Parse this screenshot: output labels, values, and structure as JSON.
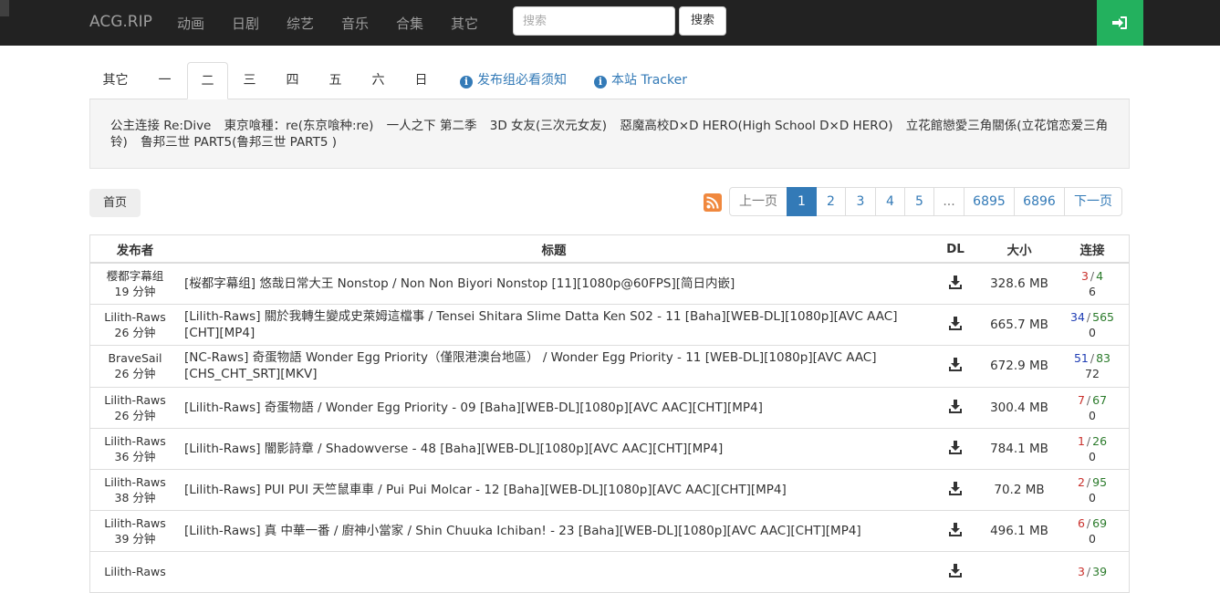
{
  "navbar": {
    "brand": "ACG.RIP",
    "links": [
      "动画",
      "日剧",
      "综艺",
      "音乐",
      "合集",
      "其它"
    ],
    "search_placeholder": "搜索",
    "search_button": "搜索",
    "login_icon": "sign-in-icon"
  },
  "tabs": {
    "days": [
      "其它",
      "一",
      "二",
      "三",
      "四",
      "五",
      "六",
      "日"
    ],
    "active": "二",
    "links": [
      "发布组必看须知",
      "本站 Tracker"
    ]
  },
  "schedule": [
    "公主连接 Re:Dive",
    "東京喰種：re(东京喰种:re)",
    "一人之下 第二季",
    "3D 女友(三次元女友)",
    "惡魔高校D×D HERO(High School D×D HERO)",
    "立花館戀愛三角關係(立花馆恋爱三角铃)",
    "鲁邦三世 PART5(鲁邦三世 PART5 )"
  ],
  "toolbar": {
    "home": "首页",
    "rss_icon": "rss-icon",
    "pagination": [
      "上一页",
      "1",
      "2",
      "3",
      "4",
      "5",
      "...",
      "6895",
      "6896",
      "下一页"
    ],
    "current_page": "1"
  },
  "table": {
    "headers": {
      "publisher": "发布者",
      "title": "标题",
      "dl": "DL",
      "size": "大小",
      "conn": "连接"
    },
    "rows": [
      {
        "publisher": "樱都字幕组",
        "time": "19 分钟",
        "title": "[桜都字幕组] 悠哉日常大王 Nonstop / Non Non Biyori Nonstop [11][1080p@60FPS][简日内嵌]",
        "size": "328.6 MB",
        "up": "3",
        "down": "4",
        "done": "6",
        "upColor": "red"
      },
      {
        "publisher": "Lilith-Raws",
        "time": "26 分钟",
        "title": "[Lilith-Raws] 關於我轉生變成史萊姆這檔事 / Tensei Shitara Slime Datta Ken S02 - 11 [Baha][WEB-DL][1080p][AVC AAC][CHT][MP4]",
        "size": "665.7 MB",
        "up": "34",
        "down": "565",
        "done": "0",
        "upColor": "blue"
      },
      {
        "publisher": "BraveSail",
        "time": "26 分钟",
        "title": "[NC-Raws] 奇蛋物語 Wonder Egg Priority（僅限港澳台地區） / Wonder Egg Priority - 11 [WEB-DL][1080p][AVC AAC][CHS_CHT_SRT][MKV]",
        "size": "672.9 MB",
        "up": "51",
        "down": "83",
        "done": "72",
        "upColor": "blue"
      },
      {
        "publisher": "Lilith-Raws",
        "time": "26 分钟",
        "title": "[Lilith-Raws] 奇蛋物語 / Wonder Egg Priority - 09 [Baha][WEB-DL][1080p][AVC AAC][CHT][MP4]",
        "size": "300.4 MB",
        "up": "7",
        "down": "67",
        "done": "0",
        "upColor": "red"
      },
      {
        "publisher": "Lilith-Raws",
        "time": "36 分钟",
        "title": "[Lilith-Raws] 闇影詩章 / Shadowverse - 48 [Baha][WEB-DL][1080p][AVC AAC][CHT][MP4]",
        "size": "784.1 MB",
        "up": "1",
        "down": "26",
        "done": "0",
        "upColor": "red"
      },
      {
        "publisher": "Lilith-Raws",
        "time": "38 分钟",
        "title": "[Lilith-Raws] PUI PUI 天竺鼠車車 / Pui Pui Molcar - 12 [Baha][WEB-DL][1080p][AVC AAC][CHT][MP4]",
        "size": "70.2 MB",
        "up": "2",
        "down": "95",
        "done": "0",
        "upColor": "red"
      },
      {
        "publisher": "Lilith-Raws",
        "time": "39 分钟",
        "title": "[Lilith-Raws] 真 中華一番 / 廚神小當家 / Shin Chuuka Ichiban! - 23 [Baha][WEB-DL][1080p][AVC AAC][CHT][MP4]",
        "size": "496.1 MB",
        "up": "6",
        "down": "69",
        "done": "0",
        "upColor": "red"
      },
      {
        "publisher": "Lilith-Raws",
        "time": "",
        "title": "",
        "size": "",
        "up": "3",
        "down": "39",
        "done": "",
        "upColor": "red"
      }
    ]
  },
  "colors": {
    "navbar": "#222222",
    "login": "#23b15e",
    "link": "#337ab7",
    "rss": "#f0883e"
  }
}
